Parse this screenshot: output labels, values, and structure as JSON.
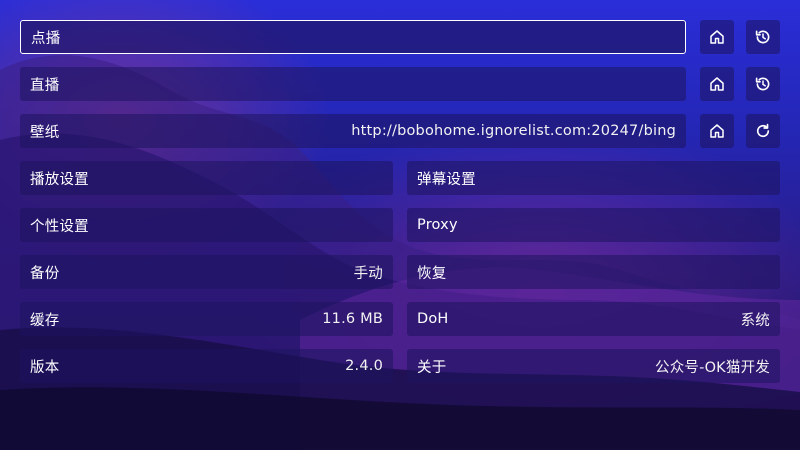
{
  "vod": {
    "label": "点播",
    "home_icon": "home-icon",
    "history_icon": "history-icon"
  },
  "live": {
    "label": "直播",
    "home_icon": "home-icon",
    "history_icon": "history-icon"
  },
  "wallpaper": {
    "label": "壁纸",
    "value": "http://bobohome.ignorelist.com:20247/bing",
    "home_icon": "home-icon",
    "refresh_icon": "refresh-icon"
  },
  "player_settings": {
    "label": "播放设置"
  },
  "danmaku_settings": {
    "label": "弹幕设置"
  },
  "personal_settings": {
    "label": "个性设置"
  },
  "proxy": {
    "label": "Proxy"
  },
  "backup": {
    "label": "备份",
    "value": "手动"
  },
  "restore": {
    "label": "恢复"
  },
  "cache": {
    "label": "缓存",
    "value": "11.6 MB"
  },
  "doh": {
    "label": "DoH",
    "value": "系统"
  },
  "version": {
    "label": "版本",
    "value": "2.4.0"
  },
  "about": {
    "label": "关于",
    "value": "公众号-OK猫开发"
  },
  "colors": {
    "focus_border": "#ffffff",
    "row_bg": "rgba(30,20,95,0.55)"
  }
}
